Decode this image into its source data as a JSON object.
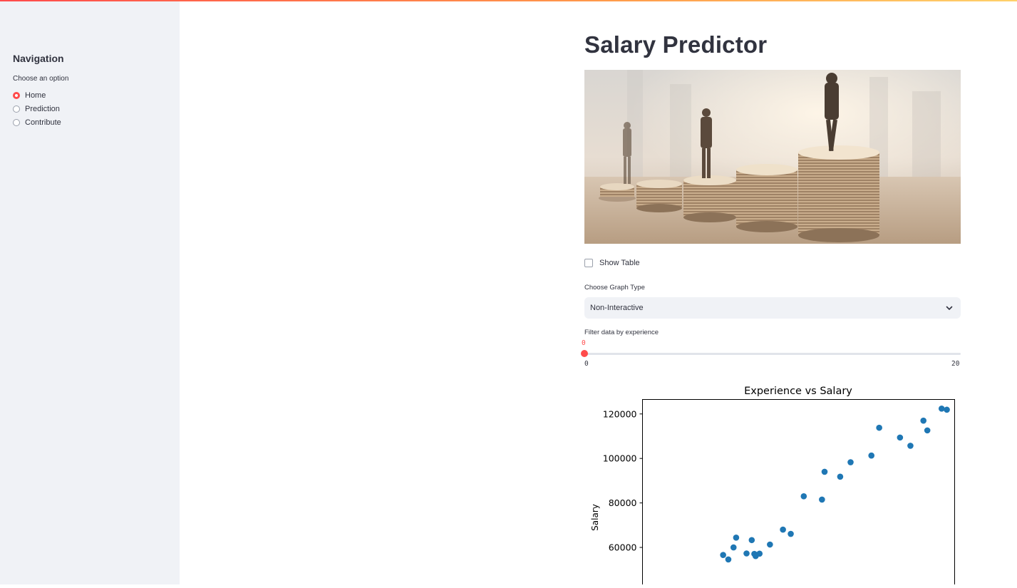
{
  "sidebar": {
    "title": "Navigation",
    "radio_label": "Choose an option",
    "options": [
      "Home",
      "Prediction",
      "Contribute"
    ],
    "selected": "Home"
  },
  "main": {
    "title": "Salary Predictor",
    "show_table_label": "Show Table",
    "graph_type_label": "Choose Graph Type",
    "graph_type_value": "Non-Interactive",
    "slider": {
      "label": "Filter data by experience",
      "value": "0",
      "min": "0",
      "max": "20"
    }
  },
  "colors": {
    "accent": "#ff4b4b",
    "sidebar_bg": "#f0f2f6",
    "marker": "#1f77b4"
  },
  "chart_data": {
    "type": "scatter",
    "title": "Experience vs Salary",
    "xlabel": "",
    "ylabel": "Salary",
    "ytick_labels": [
      "120000",
      "100000",
      "80000",
      "60000"
    ],
    "yticks": [
      120000,
      100000,
      80000,
      60000
    ],
    "series": [
      {
        "points": [
          [
            1.1,
            56600
          ],
          [
            1.3,
            54600
          ],
          [
            1.5,
            60000
          ],
          [
            1.6,
            64400
          ],
          [
            2.0,
            57300
          ],
          [
            2.2,
            63300
          ],
          [
            2.3,
            57100
          ],
          [
            2.35,
            56100
          ],
          [
            2.5,
            57200
          ],
          [
            2.9,
            61300
          ],
          [
            3.4,
            68000
          ],
          [
            3.7,
            66100
          ],
          [
            4.2,
            83000
          ],
          [
            4.9,
            81500
          ],
          [
            5.0,
            94000
          ],
          [
            5.6,
            91800
          ],
          [
            6.0,
            98300
          ],
          [
            6.8,
            101300
          ],
          [
            7.1,
            113800
          ],
          [
            7.9,
            109400
          ],
          [
            8.3,
            105700
          ],
          [
            8.8,
            117000
          ],
          [
            8.95,
            112600
          ],
          [
            9.5,
            122400
          ],
          [
            9.7,
            121900
          ]
        ]
      }
    ],
    "xlim": [
      -2.0,
      10.0
    ],
    "ylim": [
      40000,
      126500
    ]
  }
}
